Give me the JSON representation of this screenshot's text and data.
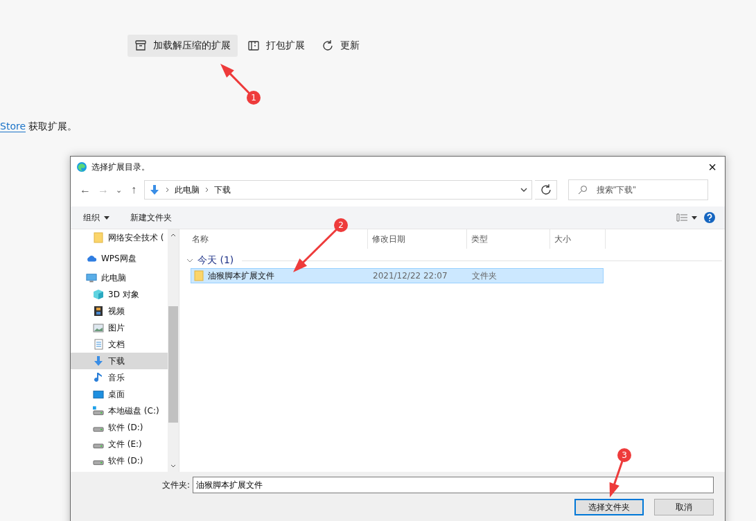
{
  "toolbar": {
    "buttons": [
      {
        "label": "加载解压缩的扩展",
        "kind": "box",
        "highlighted": true
      },
      {
        "label": "打包扩展",
        "kind": "package",
        "highlighted": false
      },
      {
        "label": "更新",
        "kind": "refresh",
        "highlighted": false
      }
    ]
  },
  "store_line": {
    "link": "Store",
    "text": "获取扩展。"
  },
  "dialog": {
    "title": "选择扩展目录。",
    "close": "×",
    "nav": {
      "back": "←",
      "forward": "→",
      "recent": "⌄",
      "up": "↑"
    },
    "breadcrumb": [
      {
        "label": "此电脑"
      },
      {
        "label": "下载"
      }
    ],
    "search": {
      "placeholder": "搜索\"下载\""
    },
    "commands": [
      {
        "label": "组织",
        "dropdown": true
      },
      {
        "label": "新建文件夹",
        "dropdown": false
      }
    ],
    "sidebar": {
      "items": [
        {
          "children": [
            {
              "label": "网络安全技术 (",
              "kind": "folder",
              "selected": false
            }
          ]
        },
        {
          "label": "WPS网盘",
          "kind": "cloud",
          "selected": false
        },
        {
          "label": "此电脑",
          "kind": "pc",
          "selected": false,
          "children": [
            {
              "label": "3D 对象",
              "kind": "cube",
              "selected": false
            },
            {
              "label": "视频",
              "kind": "film",
              "selected": false
            },
            {
              "label": "图片",
              "kind": "image",
              "selected": false
            },
            {
              "label": "文档",
              "kind": "doc",
              "selected": false
            },
            {
              "label": "下载",
              "kind": "download",
              "selected": true
            },
            {
              "label": "音乐",
              "kind": "music",
              "selected": false
            },
            {
              "label": "桌面",
              "kind": "desktop",
              "selected": false
            },
            {
              "label": "本地磁盘 (C:)",
              "kind": "disk-c",
              "selected": false
            },
            {
              "label": "软件 (D:)",
              "kind": "disk",
              "selected": false
            },
            {
              "label": "文件 (E:)",
              "kind": "disk",
              "selected": false
            },
            {
              "label": "软件 (D:)",
              "kind": "disk",
              "selected": false
            }
          ]
        }
      ]
    },
    "table": {
      "columns": [
        "名称",
        "修改日期",
        "类型",
        "大小"
      ],
      "groups": [
        {
          "label": "今天 (1)",
          "expanded": true,
          "rows": [
            {
              "name": "油猴脚本扩展文件",
              "date": "2021/12/22 22:07",
              "type": "文件夹",
              "selected": true
            }
          ]
        }
      ]
    },
    "folder_field": {
      "label": "文件夹:",
      "value": "油猴脚本扩展文件"
    },
    "buttons": [
      {
        "label": "选择文件夹",
        "default": true
      },
      {
        "label": "取消",
        "default": false
      }
    ]
  },
  "annotations": [
    {
      "label": "1"
    },
    {
      "label": "2"
    },
    {
      "label": "3"
    }
  ]
}
